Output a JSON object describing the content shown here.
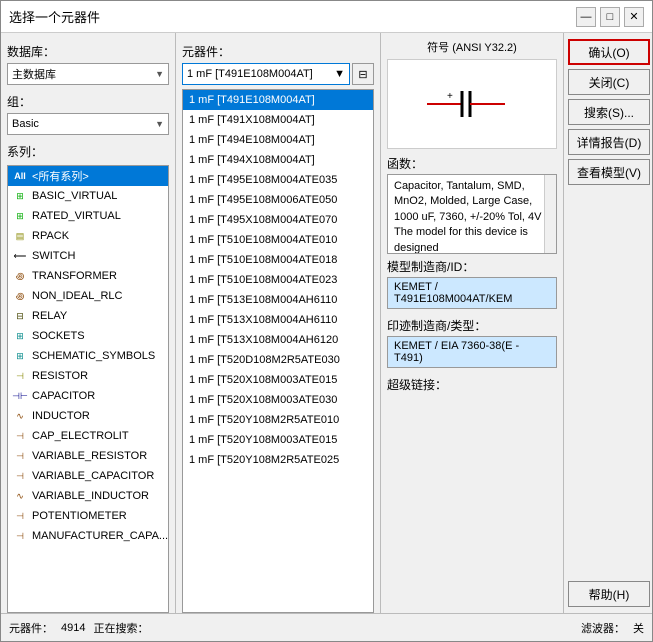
{
  "window": {
    "title": "选择一个元器件",
    "min_btn": "—",
    "max_btn": "□",
    "close_btn": "✕"
  },
  "left_panel": {
    "database_label": "数据库：",
    "database_value": "主数据库",
    "group_label": "组：",
    "group_value": "Basic",
    "series_label": "系列：",
    "series_items": [
      {
        "id": "all",
        "icon": "All",
        "label": "<所有系列>",
        "selected": true
      },
      {
        "id": "basic_virtual",
        "icon": "⊞",
        "label": "BASIC_VIRTUAL",
        "selected": false
      },
      {
        "id": "rated_virtual",
        "icon": "⊞",
        "label": "RATED_VIRTUAL",
        "selected": false
      },
      {
        "id": "rpack",
        "icon": "≡≡",
        "label": "RPACK",
        "selected": false
      },
      {
        "id": "switch",
        "icon": "⟵",
        "label": "SWITCH",
        "selected": false
      },
      {
        "id": "transformer",
        "icon": "꩜",
        "label": "TRANSFORMER",
        "selected": false
      },
      {
        "id": "non_ideal_rlc",
        "icon": "꩜",
        "label": "NON_IDEAL_RLC",
        "selected": false
      },
      {
        "id": "relay",
        "icon": "꩜",
        "label": "RELAY",
        "selected": false
      },
      {
        "id": "sockets",
        "icon": "꩜",
        "label": "SOCKETS",
        "selected": false
      },
      {
        "id": "schematic_symbols",
        "icon": "꩜",
        "label": "SCHEMATIC_SYMBOLS",
        "selected": false
      },
      {
        "id": "resistor",
        "icon": "꩜",
        "label": "RESISTOR",
        "selected": false
      },
      {
        "id": "capacitor",
        "icon": "꩜",
        "label": "CAPACITOR",
        "selected": false
      },
      {
        "id": "inductor",
        "icon": "꩜",
        "label": "INDUCTOR",
        "selected": false
      },
      {
        "id": "cap_electrolit",
        "icon": "꩜",
        "label": "CAP_ELECTROLIT",
        "selected": false
      },
      {
        "id": "variable_resistor",
        "icon": "꩜",
        "label": "VARIABLE_RESISTOR",
        "selected": false
      },
      {
        "id": "variable_capacitor",
        "icon": "꩜",
        "label": "VARIABLE_CAPACITOR",
        "selected": false
      },
      {
        "id": "variable_inductor",
        "icon": "꩜",
        "label": "VARIABLE_INDUCTOR",
        "selected": false
      },
      {
        "id": "potentiometer",
        "icon": "꩜",
        "label": "POTENTIOMETER",
        "selected": false
      },
      {
        "id": "manufacturer_capa",
        "icon": "꩜",
        "label": "MANUFACTURER_CAPA...",
        "selected": false
      }
    ]
  },
  "middle_panel": {
    "component_label": "元器件：",
    "selected_component": "1 mF  [T491E108M004AT]",
    "filter_icon": "▼",
    "components": [
      {
        "label": "1 mF  [T491E108M004AT]",
        "selected": true
      },
      {
        "label": "1 mF  [T491X108M004AT]",
        "selected": false
      },
      {
        "label": "1 mF  [T494E108M004AT]",
        "selected": false
      },
      {
        "label": "1 mF  [T494X108M004AT]",
        "selected": false
      },
      {
        "label": "1 mF  [T495E108M004ATE035",
        "selected": false
      },
      {
        "label": "1 mF  [T495E108M006ATE050",
        "selected": false
      },
      {
        "label": "1 mF  [T495X108M004ATE070",
        "selected": false
      },
      {
        "label": "1 mF  [T510E108M004ATE010",
        "selected": false
      },
      {
        "label": "1 mF  [T510E108M004ATE018",
        "selected": false
      },
      {
        "label": "1 mF  [T510E108M004ATE023",
        "selected": false
      },
      {
        "label": "1 mF  [T513E108M004AH6110",
        "selected": false
      },
      {
        "label": "1 mF  [T513X108M004AH6110",
        "selected": false
      },
      {
        "label": "1 mF  [T513X108M004AH6120",
        "selected": false
      },
      {
        "label": "1 mF  [T520D108M2R5ATE030",
        "selected": false
      },
      {
        "label": "1 mF  [T520X108M003ATE015",
        "selected": false
      },
      {
        "label": "1 mF  [T520X108M003ATE030",
        "selected": false
      },
      {
        "label": "1 mF  [T520Y108M2R5ATE010",
        "selected": false
      },
      {
        "label": "1 mF  [T520Y108M003ATE015",
        "selected": false
      },
      {
        "label": "1 mF  [T520Y108M2R5ATE025",
        "selected": false
      }
    ]
  },
  "right_panel": {
    "symbol_header": "符号 (ANSI Y32.2)",
    "function_label": "函数：",
    "function_text": "Capacitor, Tantalum, SMD, MnO2, Molded, Large Case, 1000 uF, 7360, +/-20% Tol, 4V",
    "function_more": "The model for this device is designed",
    "model_label": "模型制造商/ID：",
    "model_value": "KEMET / T491E108M004AT/KEM",
    "footprint_label": "印迹制造商/类型：",
    "footprint_value": "KEMET / EIA 7360-38(E - T491)",
    "hyperlink_label": "超级链接："
  },
  "buttons": {
    "confirm": "确认(O)",
    "close": "关闭(C)",
    "search": "搜索(S)...",
    "detail_report": "详情报告(D)",
    "view_model": "查看模型(V)",
    "help": "帮助(H)"
  },
  "bottom_bar": {
    "component_count_label": "元器件：",
    "component_count": "4914",
    "searching_label": "正在搜索：",
    "searching_value": "",
    "filter_label": "滤波器：",
    "filter_value": "关"
  }
}
